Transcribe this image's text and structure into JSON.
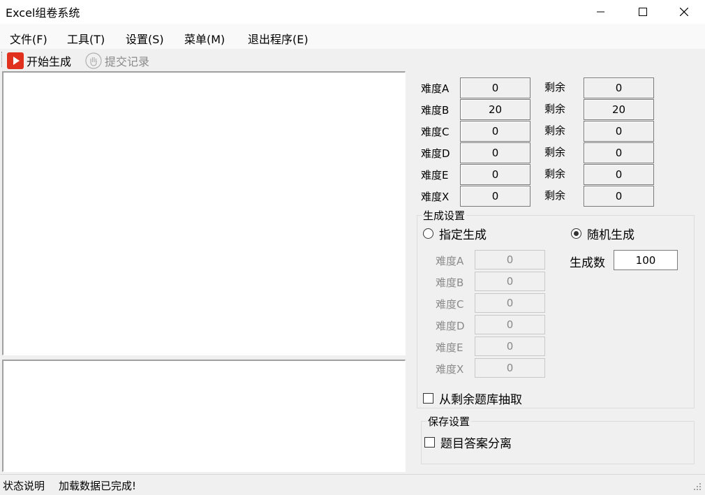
{
  "window": {
    "title": "Excel组卷系统"
  },
  "menu": [
    "文件(F)",
    "工具(T)",
    "设置(S)",
    "菜单(M)",
    "退出程序(E)"
  ],
  "toolbar": {
    "start_label": "开始生成",
    "submit_label": "提交记录"
  },
  "difficulty_rows": [
    {
      "label": "难度A",
      "value": "0",
      "remain_label": "剩余",
      "remain": "0"
    },
    {
      "label": "难度B",
      "value": "20",
      "remain_label": "剩余",
      "remain": "20"
    },
    {
      "label": "难度C",
      "value": "0",
      "remain_label": "剩余",
      "remain": "0"
    },
    {
      "label": "难度D",
      "value": "0",
      "remain_label": "剩余",
      "remain": "0"
    },
    {
      "label": "难度E",
      "value": "0",
      "remain_label": "剩余",
      "remain": "0"
    },
    {
      "label": "难度X",
      "value": "0",
      "remain_label": "剩余",
      "remain": "0"
    }
  ],
  "generate": {
    "group_title": "生成设置",
    "specify_label": "指定生成",
    "random_label": "随机生成",
    "random_selected": true,
    "count_label": "生成数",
    "count_value": "100",
    "specify_rows": [
      {
        "label": "难度A",
        "value": "0"
      },
      {
        "label": "难度B",
        "value": "0"
      },
      {
        "label": "难度C",
        "value": "0"
      },
      {
        "label": "难度D",
        "value": "0"
      },
      {
        "label": "难度E",
        "value": "0"
      },
      {
        "label": "难度X",
        "value": "0"
      }
    ],
    "draw_remaining_label": "从剩余题库抽取",
    "draw_remaining_checked": false
  },
  "save": {
    "group_title": "保存设置",
    "separate_label": "题目答案分离",
    "separate_checked": false
  },
  "status": {
    "caption": "状态说明",
    "message": "加载数据已完成!"
  },
  "colors": {
    "play_red": "#e0301e",
    "accent": "#000000"
  }
}
